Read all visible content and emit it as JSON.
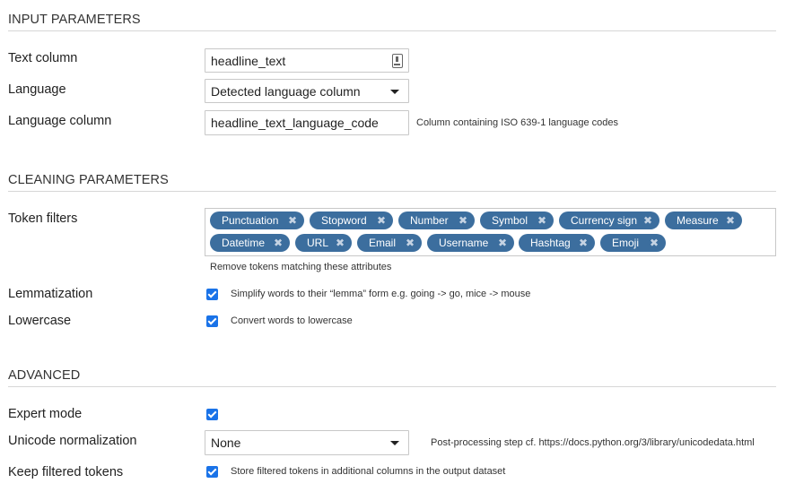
{
  "sections": {
    "input": "INPUT PARAMETERS",
    "cleaning": "CLEANING PARAMETERS",
    "advanced": "ADVANCED"
  },
  "text_column": {
    "label": "Text column",
    "value": "headline_text",
    "icon": "column-icon"
  },
  "language": {
    "label": "Language",
    "value": "Detected language column"
  },
  "language_column": {
    "label": "Language column",
    "value": "headline_text_language_code",
    "help": "Column containing ISO 639-1 language codes"
  },
  "token_filters": {
    "label": "Token filters",
    "help": "Remove tokens matching these attributes",
    "remove_glyph": "✖",
    "tags": [
      "Punctuation",
      "Stopword",
      "Number",
      "Symbol",
      "Currency sign",
      "Measure",
      "Datetime",
      "URL",
      "Email",
      "Username",
      "Hashtag",
      "Emoji"
    ]
  },
  "lemmatization": {
    "label": "Lemmatization",
    "checked": true,
    "text": "Simplify words to their “lemma” form e.g. going -> go, mice -> mouse"
  },
  "lowercase": {
    "label": "Lowercase",
    "checked": true,
    "text": "Convert words to lowercase"
  },
  "expert_mode": {
    "label": "Expert mode",
    "checked": true
  },
  "unicode_normalization": {
    "label": "Unicode normalization",
    "value": "None",
    "help": "Post-processing step cf. https://docs.python.org/3/library/unicodedata.html"
  },
  "keep_filtered_tokens": {
    "label": "Keep filtered tokens",
    "checked": true,
    "text": "Store filtered tokens in additional columns in the output dataset"
  },
  "colors": {
    "tag_bg": "#3c6e9e",
    "checkbox": "#1a73e8"
  }
}
